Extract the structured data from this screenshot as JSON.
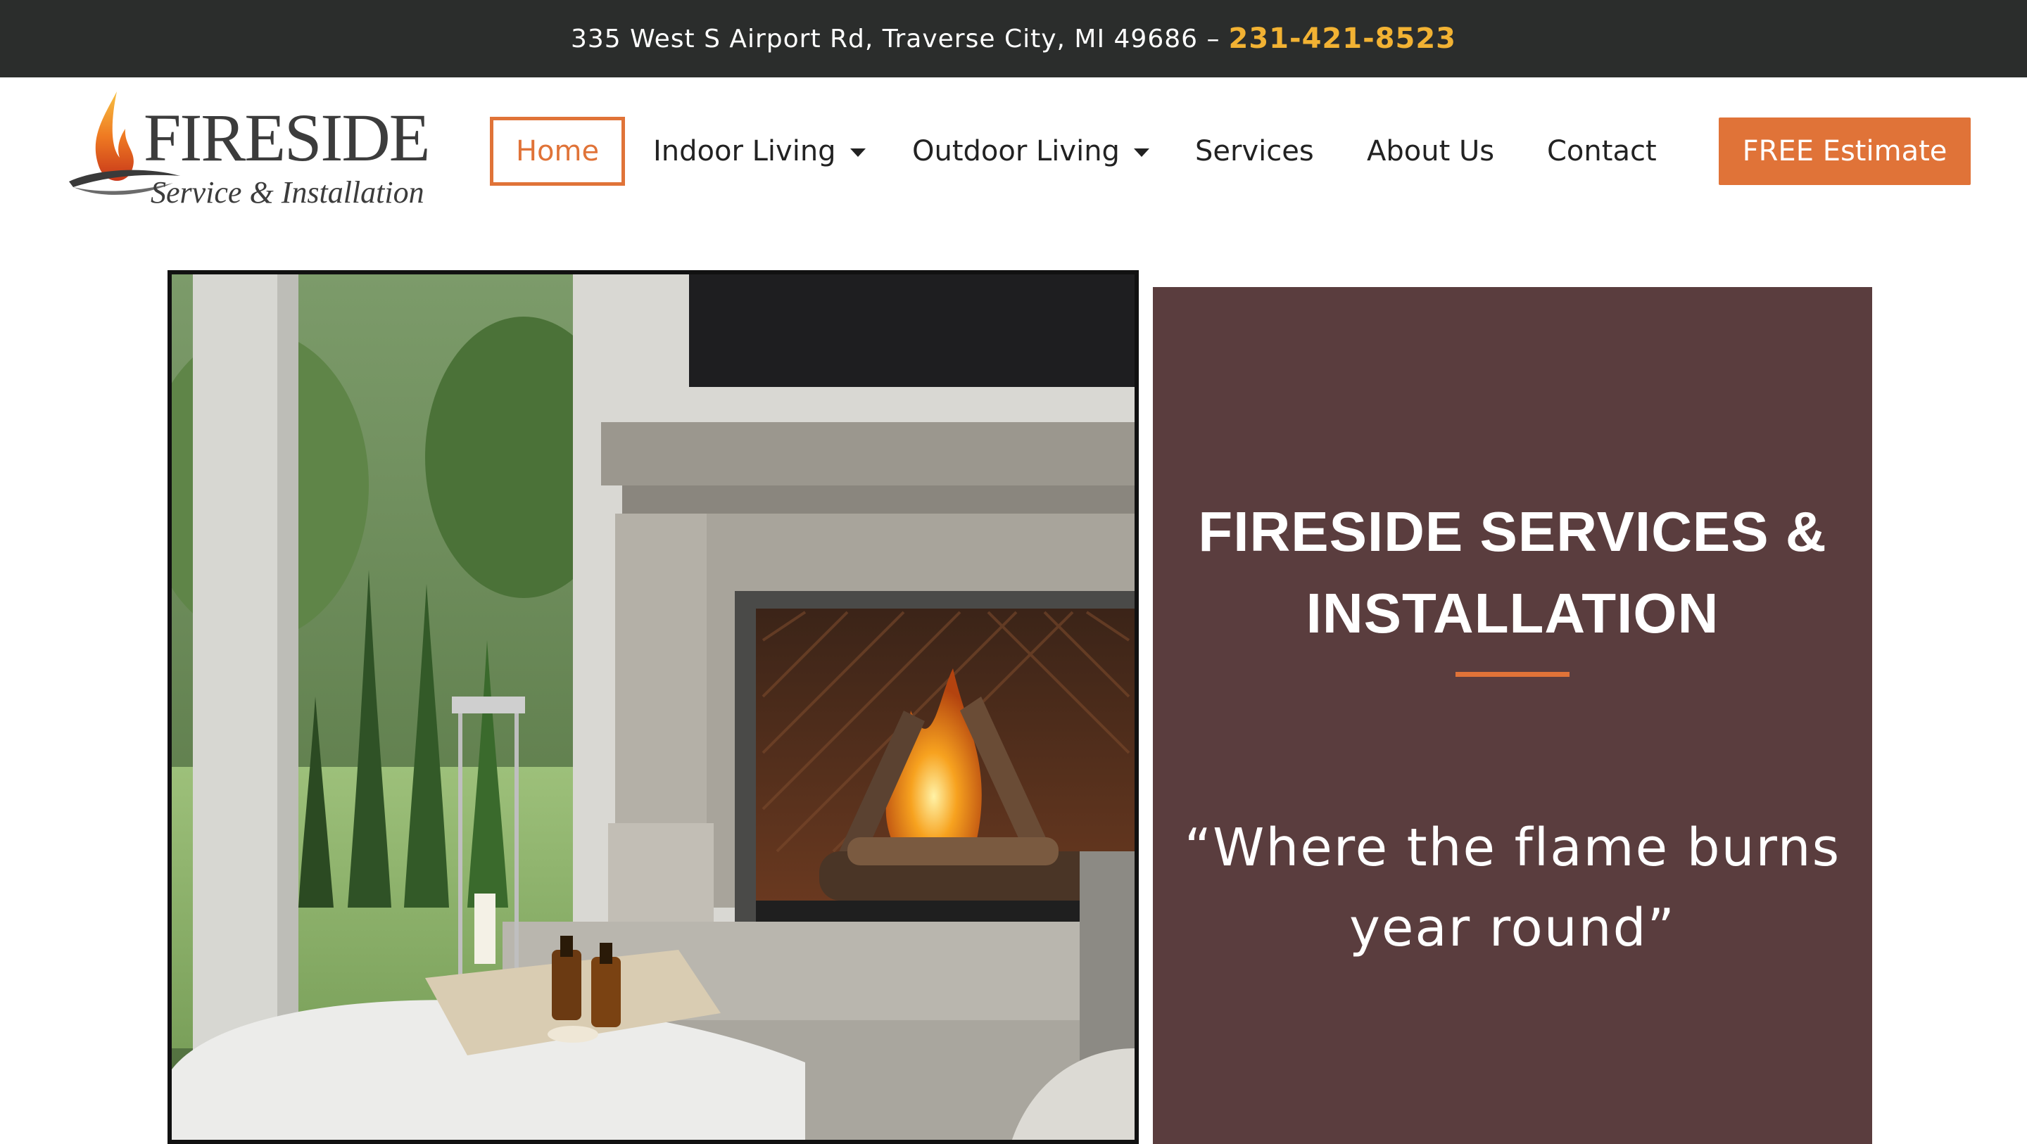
{
  "topbar": {
    "address": "335 West S Airport Rd, Traverse City, MI 49686 –",
    "phone": "231-421-8523"
  },
  "logo": {
    "wordmark": "FIRESIDE",
    "tagline": "Service & Installation"
  },
  "nav": {
    "items": [
      {
        "label": "Home",
        "active": true
      },
      {
        "label": "Indoor Living",
        "has_dropdown": true
      },
      {
        "label": "Outdoor Living",
        "has_dropdown": true
      },
      {
        "label": "Services"
      },
      {
        "label": "About Us"
      },
      {
        "label": "Contact"
      }
    ],
    "cta": "FREE Estimate"
  },
  "hero": {
    "title": "FIRESIDE SERVICES & INSTALLATION",
    "quote": "“Where the flame burns year round”"
  },
  "colors": {
    "topbar_bg": "#2b2d2c",
    "phone": "#f2b233",
    "accent": "#e07338",
    "panel_bg": "#5a3d3e"
  }
}
